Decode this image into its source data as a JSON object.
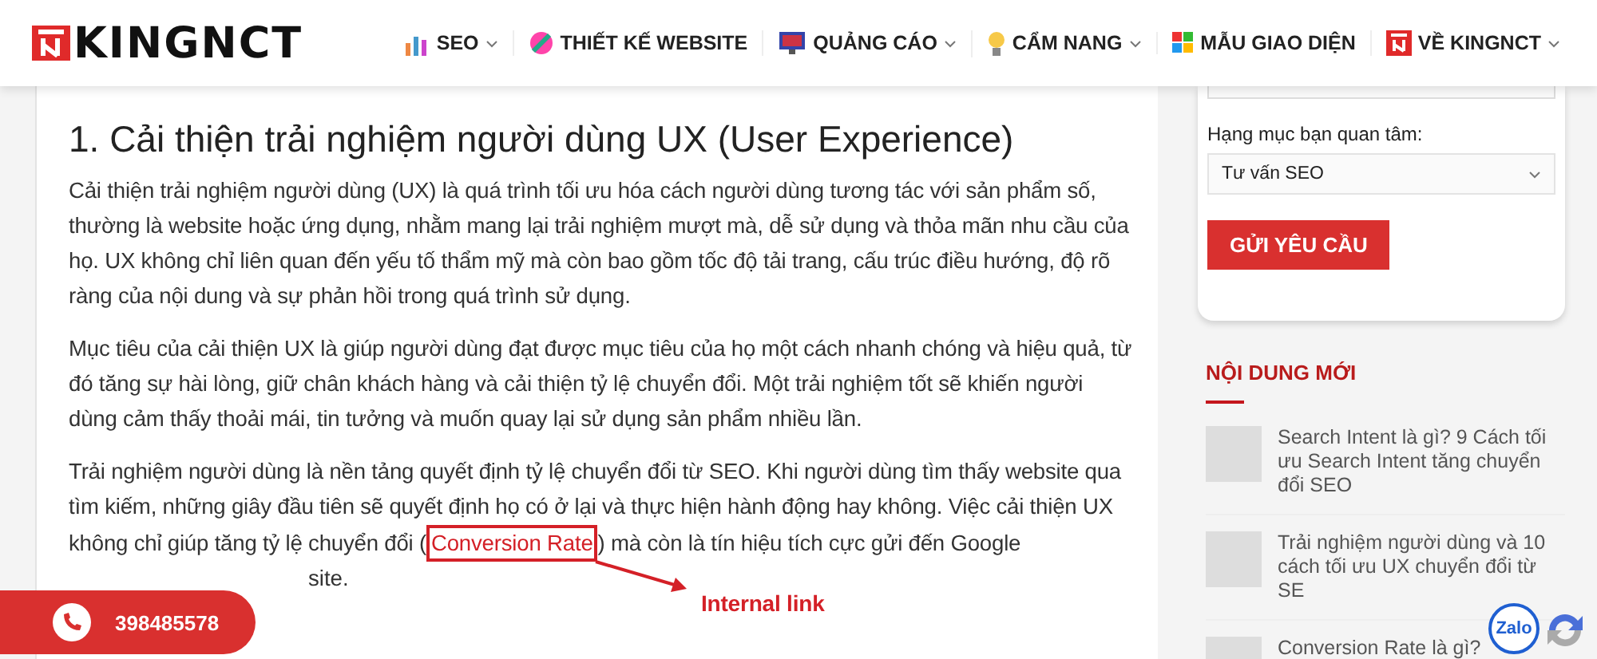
{
  "header": {
    "logo": "KINGNCT",
    "nav": [
      {
        "label": "SEO",
        "dropdown": true
      },
      {
        "label": "THIẾT KẾ WEBSITE",
        "dropdown": false
      },
      {
        "label": "QUẢNG CÁO",
        "dropdown": true
      },
      {
        "label": "CẨM NANG",
        "dropdown": true
      },
      {
        "label": "MẪU GIAO DIỆN",
        "dropdown": false
      },
      {
        "label": "VỀ KINGNCT",
        "dropdown": true
      }
    ]
  },
  "article": {
    "heading": "1. Cải thiện trải nghiệm người dùng UX (User Experience)",
    "paragraphs": [
      "Cải thiện trải nghiệm người dùng (UX) là quá trình tối ưu hóa cách người dùng tương tác với sản phẩm số, thường là website hoặc ứng dụng, nhằm mang lại trải nghiệm mượt mà, dễ sử dụng và thỏa mãn nhu cầu của họ. UX không chỉ liên quan đến yếu tố thẩm mỹ mà còn bao gồm tốc độ tải trang, cấu trúc điều hướng, độ rõ ràng của nội dung và sự phản hồi trong quá trình sử dụng.",
      "Mục tiêu của cải thiện UX là giúp người dùng đạt được mục tiêu của họ một cách nhanh chóng và hiệu quả, từ đó tăng sự hài lòng, giữ chân khách hàng và cải thiện tỷ lệ chuyển đổi. Một trải nghiệm tốt sẽ khiến người dùng cảm thấy thoải mái, tin tưởng và muốn quay lại sử dụng sản phẩm nhiều lần."
    ],
    "last_paragraph": {
      "before": "Trải nghiệm người dùng là nền tảng quyết định tỷ lệ chuyển đổi từ SEO. Khi người dùng tìm thấy website qua tìm kiếm, những giây đầu tiên sẽ quyết định họ có ở lại và thực hiện hành động hay không. Việc cải thiện UX không chỉ giúp tăng tỷ lệ chuyển đổi (",
      "link": "Conversion Rate",
      "after": ") mà còn là tín hiệu tích cực gửi đến Google",
      "tail": "site."
    },
    "annotation": "Internal link"
  },
  "sidebar": {
    "form": {
      "label": "Hạng mục bạn quan tâm:",
      "select_value": "Tư vấn SEO",
      "button": "GỬI YÊU CẦU"
    },
    "section_title": "NỘI DUNG MỚI",
    "posts": [
      {
        "title": "Search Intent là gì? 9 Cách tối ưu Search Intent tăng chuyển đổi SEO"
      },
      {
        "title": "Trải nghiệm người dùng và 10 cách tối ưu UX chuyển đổi từ SE"
      },
      {
        "title": "Conversion Rate là gì?"
      }
    ]
  },
  "widgets": {
    "phone": "398485578",
    "zalo": "Zalo"
  }
}
